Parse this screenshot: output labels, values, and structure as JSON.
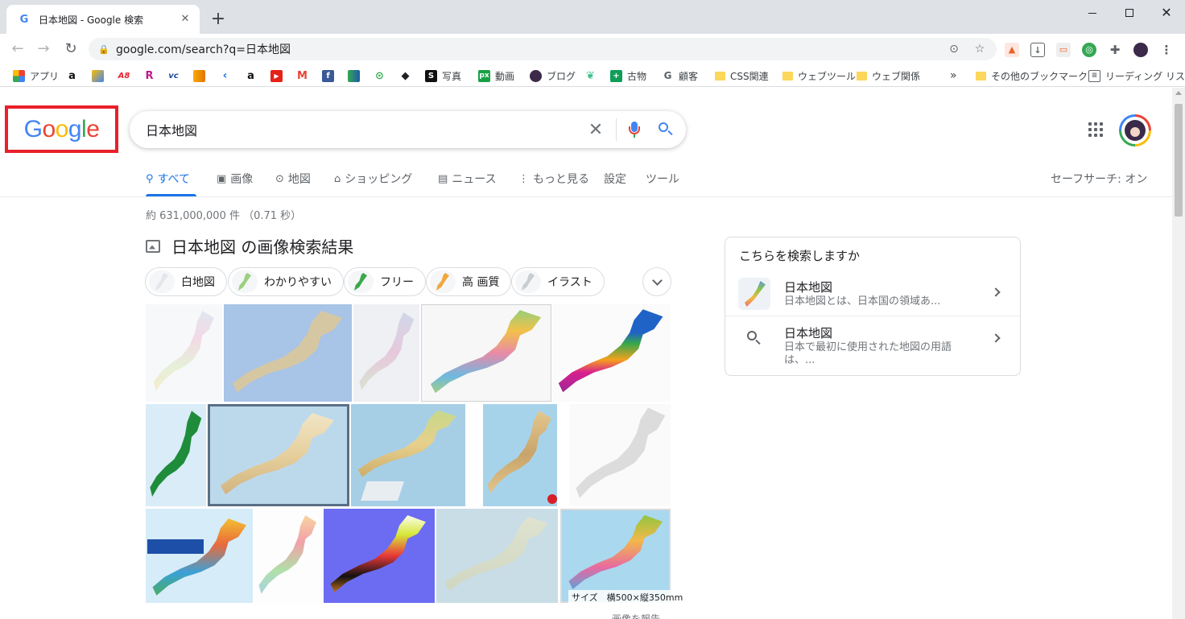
{
  "browser": {
    "tab_title": "日本地図 - Google 検索",
    "url": "google.com/search?q=日本地図",
    "new_tab_label": "+"
  },
  "bookmarks": [
    {
      "label": "アプリ",
      "icon": "apps-grid-icon"
    },
    {
      "label": "",
      "icon": "amazon-icon"
    },
    {
      "label": "",
      "icon": "google-ads-icon"
    },
    {
      "label": "",
      "icon": "a8-icon"
    },
    {
      "label": "",
      "icon": "rakuten-icon"
    },
    {
      "label": "",
      "icon": "vc-icon"
    },
    {
      "label": "",
      "icon": "analytics-icon"
    },
    {
      "label": "",
      "icon": "arrow-icon"
    },
    {
      "label": "",
      "icon": "amazon-icon"
    },
    {
      "label": "",
      "icon": "youtube-icon"
    },
    {
      "label": "",
      "icon": "gmail-icon"
    },
    {
      "label": "",
      "icon": "facebook-icon"
    },
    {
      "label": "",
      "icon": "chart-icon"
    },
    {
      "label": "",
      "icon": "maps-icon"
    },
    {
      "label": "",
      "icon": "diamond-icon"
    },
    {
      "label": "写真",
      "icon": "photo-icon"
    },
    {
      "label": "動画",
      "icon": "px-icon"
    },
    {
      "label": "ブログ",
      "icon": "blog-icon"
    },
    {
      "label": "",
      "icon": "leaf-icon"
    },
    {
      "label": "古物",
      "icon": "sheets-icon"
    },
    {
      "label": "顧客",
      "icon": "google-g-icon"
    },
    {
      "label": "CSS関連",
      "icon": "folder-icon"
    },
    {
      "label": "ウェブツール",
      "icon": "folder-icon"
    },
    {
      "label": "ウェブ関係",
      "icon": "folder-icon"
    },
    {
      "label": "その他のブックマーク",
      "icon": "folder-icon"
    },
    {
      "label": "リーディング リスト",
      "icon": "reading-list-icon"
    }
  ],
  "bookmarks_overflow": "»",
  "search": {
    "logo_letters": [
      "G",
      "o",
      "o",
      "g",
      "l",
      "e"
    ],
    "query": "日本地図",
    "clear_glyph": "✕"
  },
  "tabs": [
    {
      "label": "すべて",
      "icon": "search-icon",
      "glyph": "🔍"
    },
    {
      "label": "画像",
      "icon": "image-icon",
      "glyph": "▣"
    },
    {
      "label": "地図",
      "icon": "pin-icon",
      "glyph": "⊙"
    },
    {
      "label": "ショッピング",
      "icon": "tag-icon",
      "glyph": "⌂"
    },
    {
      "label": "ニュース",
      "icon": "news-icon",
      "glyph": "▤"
    },
    {
      "label": "もっと見る",
      "icon": "more-icon",
      "glyph": "⋮"
    },
    {
      "label": "設定",
      "icon": "",
      "glyph": ""
    },
    {
      "label": "ツール",
      "icon": "",
      "glyph": ""
    }
  ],
  "safesearch": "セーフサーチ: オン",
  "results": {
    "stats": "約 631,000,000 件 （0.71 秒）",
    "images_heading": "日本地図 の画像検索結果",
    "chips": [
      "白地図",
      "わかりやすい",
      "フリー",
      "高 画質",
      "イラスト"
    ],
    "size_caption": "サイズ　横500×縦350mm",
    "report_text": "画像を報告"
  },
  "did_you_mean": {
    "title": "こちらを検索しますか",
    "items": [
      {
        "name": "日本地図",
        "desc": "日本地図とは、日本国の領域あ..."
      },
      {
        "name": "日本地図",
        "desc": "日本で最初に使用された地図の用語は、..."
      }
    ]
  },
  "colors": {
    "accent": "#1a73e8",
    "highlight_box": "#e8202a"
  }
}
